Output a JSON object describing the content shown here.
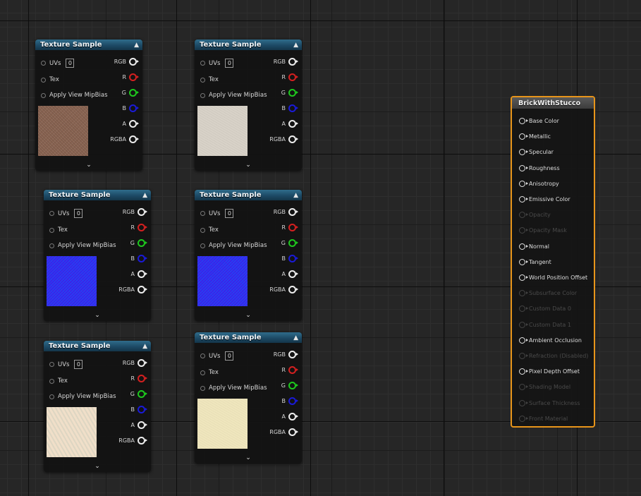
{
  "texture_nodes": [
    {
      "title": "Texture Sample",
      "uv_label": "UVs",
      "uv_value": "0",
      "tex_label": "Tex",
      "mip_label": "Apply View MipBias",
      "outputs": [
        "RGB",
        "R",
        "G",
        "B",
        "A",
        "RGBA"
      ],
      "preview_color": "#8a6553"
    },
    {
      "title": "Texture Sample",
      "uv_label": "UVs",
      "uv_value": "0",
      "tex_label": "Tex",
      "mip_label": "Apply View MipBias",
      "outputs": [
        "RGB",
        "R",
        "G",
        "B",
        "A",
        "RGBA"
      ],
      "preview_color": "#d8d2c8"
    },
    {
      "title": "Texture Sample",
      "uv_label": "UVs",
      "uv_value": "0",
      "tex_label": "Tex",
      "mip_label": "Apply View MipBias",
      "outputs": [
        "RGB",
        "R",
        "G",
        "B",
        "A",
        "RGBA"
      ],
      "preview_color": "#2c2cf0"
    },
    {
      "title": "Texture Sample",
      "uv_label": "UVs",
      "uv_value": "0",
      "tex_label": "Tex",
      "mip_label": "Apply View MipBias",
      "outputs": [
        "RGB",
        "R",
        "G",
        "B",
        "A",
        "RGBA"
      ],
      "preview_color": "#2c2cf0"
    },
    {
      "title": "Texture Sample",
      "uv_label": "UVs",
      "uv_value": "0",
      "tex_label": "Tex",
      "mip_label": "Apply View MipBias",
      "outputs": [
        "RGB",
        "R",
        "G",
        "B",
        "A",
        "RGBA"
      ],
      "preview_color": "#f0dfc9"
    },
    {
      "title": "Texture Sample",
      "uv_label": "UVs",
      "uv_value": "0",
      "tex_label": "Tex",
      "mip_label": "Apply View MipBias",
      "outputs": [
        "RGB",
        "R",
        "G",
        "B",
        "A",
        "RGBA"
      ],
      "preview_color": "#efe6bd"
    }
  ],
  "pin_colors": {
    "R": "#d42020",
    "G": "#1ec81e",
    "B": "#1a1ad8",
    "default": "#ededed"
  },
  "material_node": {
    "title": "BrickWithStucco",
    "accent_color": "#e8951a",
    "inputs": [
      {
        "label": "Base Color",
        "enabled": true
      },
      {
        "label": "Metallic",
        "enabled": true
      },
      {
        "label": "Specular",
        "enabled": true
      },
      {
        "label": "Roughness",
        "enabled": true
      },
      {
        "label": "Anisotropy",
        "enabled": true
      },
      {
        "label": "Emissive Color",
        "enabled": true
      },
      {
        "label": "Opacity",
        "enabled": false
      },
      {
        "label": "Opacity Mask",
        "enabled": false
      },
      {
        "label": "Normal",
        "enabled": true
      },
      {
        "label": "Tangent",
        "enabled": true
      },
      {
        "label": "World Position Offset",
        "enabled": true
      },
      {
        "label": "Subsurface Color",
        "enabled": false
      },
      {
        "label": "Custom Data 0",
        "enabled": false
      },
      {
        "label": "Custom Data 1",
        "enabled": false
      },
      {
        "label": "Ambient Occlusion",
        "enabled": true
      },
      {
        "label": "Refraction (Disabled)",
        "enabled": false
      },
      {
        "label": "Pixel Depth Offset",
        "enabled": true
      },
      {
        "label": "Shading Model",
        "enabled": false
      },
      {
        "label": "Surface Thickness",
        "enabled": false
      },
      {
        "label": "Front Material",
        "enabled": false
      }
    ]
  },
  "icons": {
    "collapse": "chevron-up-icon",
    "expand": "chevron-down-icon",
    "pin": "exec-pin-icon"
  }
}
